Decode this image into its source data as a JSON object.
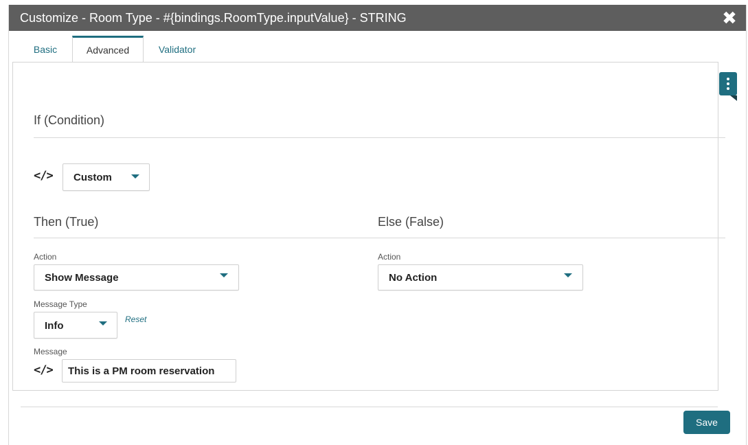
{
  "dialog": {
    "title": "Customize - Room Type - #{bindings.RoomType.inputValue} - STRING",
    "close_glyph": "✖"
  },
  "tabs": [
    {
      "label": "Basic",
      "active": false
    },
    {
      "label": "Advanced",
      "active": true
    },
    {
      "label": "Validator",
      "active": false
    }
  ],
  "condition": {
    "heading": "If (Condition)",
    "code_glyph": "</>",
    "type_value": "Custom"
  },
  "then": {
    "heading": "Then (True)",
    "action_label": "Action",
    "action_value": "Show Message",
    "message_type_label": "Message Type",
    "message_type_value": "Info",
    "reset_label": "Reset",
    "message_label": "Message",
    "message_value": "This is a PM room reservation"
  },
  "else": {
    "heading": "Else (False)",
    "action_label": "Action",
    "action_value": "No Action"
  },
  "footer": {
    "save_label": "Save"
  },
  "colors": {
    "accent": "#1f6e80",
    "titlebar": "#5e5e5e"
  },
  "icons": [
    "close-icon",
    "code-icon",
    "chevron-down-icon",
    "kebab-menu-icon"
  ]
}
